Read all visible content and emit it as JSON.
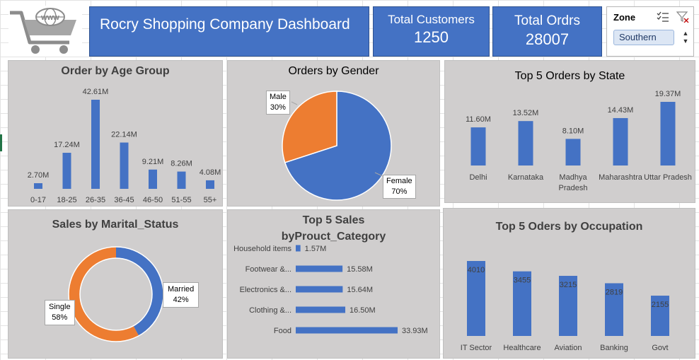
{
  "header": {
    "title": "Rocry Shopping Company Dashboard",
    "logo_text": "www",
    "kpis": [
      {
        "label": "Total Customers",
        "value": "1250"
      },
      {
        "label": "Total Ordrs",
        "value": "28007"
      }
    ]
  },
  "slicer": {
    "title": "Zone",
    "selected": "Southern",
    "icons": [
      "multi-select-icon",
      "clear-filter-icon"
    ]
  },
  "colors": {
    "blue": "#4472c4",
    "orange": "#ed7d31",
    "panel": "#d0cece"
  },
  "charts": {
    "age": {
      "title": "Order by Age Group",
      "chart_data": {
        "type": "bar",
        "categories": [
          "0-17",
          "18-25",
          "26-35",
          "36-45",
          "46-50",
          "51-55",
          "55+"
        ],
        "values": [
          2.7,
          17.24,
          42.61,
          22.14,
          9.21,
          8.26,
          4.08
        ],
        "labels": [
          "2.70M",
          "17.24M",
          "42.61M",
          "22.14M",
          "9.21M",
          "8.26M",
          "4.08M"
        ]
      }
    },
    "gender": {
      "title": "Orders by Gender",
      "chart_data": {
        "type": "pie",
        "categories": [
          "Female",
          "Male"
        ],
        "values": [
          70,
          30
        ],
        "labels": [
          "70%",
          "30%"
        ]
      }
    },
    "state": {
      "title": "Top 5 Orders by State",
      "chart_data": {
        "type": "bar",
        "categories": [
          "Delhi",
          "Karnataka",
          "Madhya Pradesh",
          "Maharashtra",
          "Uttar Pradesh"
        ],
        "values": [
          11.6,
          13.52,
          8.1,
          14.43,
          19.37
        ],
        "labels": [
          "11.60M",
          "13.52M",
          "8.10M",
          "14.43M",
          "19.37M"
        ]
      }
    },
    "marital": {
      "title": "Sales by Marital_Status",
      "chart_data": {
        "type": "pie",
        "categories": [
          "Married",
          "Single"
        ],
        "values": [
          42,
          58
        ],
        "labels": [
          "42%",
          "58%"
        ]
      }
    },
    "product": {
      "title_line1": "Top 5 Sales",
      "title_line2": "byProuct_Category",
      "chart_data": {
        "type": "bar",
        "orientation": "horizontal",
        "categories": [
          "Household items",
          "Footwear &...",
          "Electronics &...",
          "Clothing &...",
          "Food"
        ],
        "values": [
          1.57,
          15.58,
          15.64,
          16.5,
          33.93
        ],
        "labels": [
          "1.57M",
          "15.58M",
          "15.64M",
          "16.50M",
          "33.93M"
        ]
      }
    },
    "occupation": {
      "title": "Top 5 Oders by Occupation",
      "chart_data": {
        "type": "bar",
        "categories": [
          "IT Sector",
          "Healthcare",
          "Aviation",
          "Banking",
          "Govt"
        ],
        "values": [
          4010,
          3455,
          3215,
          2819,
          2155
        ],
        "labels": [
          "4010",
          "3455",
          "3215",
          "2819",
          "2155"
        ]
      }
    }
  }
}
